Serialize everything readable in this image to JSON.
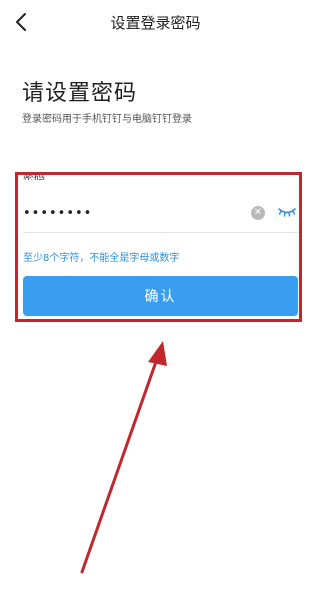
{
  "nav": {
    "title": "设置登录密码",
    "back_icon": "chevron-left-icon"
  },
  "heading": "请设置密码",
  "subtitle": "登录密码用于手机钉钉与电脑钉钉登录",
  "password_field": {
    "label": "密码",
    "value": "••••••••",
    "clear_icon": "clear-circle-icon",
    "clear_glyph": "✕",
    "visibility_icon": "eye-closed-icon"
  },
  "hint": "至少8个字符，不能全是字母或数字",
  "confirm_label": "确认",
  "colors": {
    "accent": "#3a9ef0",
    "hint": "#2e8fd8",
    "annotation": "#c0282d"
  }
}
